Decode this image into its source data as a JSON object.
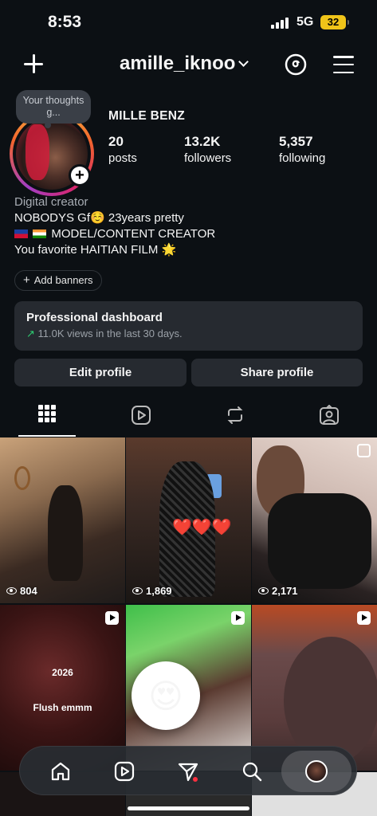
{
  "status_bar": {
    "time": "8:53",
    "network": "5G",
    "battery": "32"
  },
  "header": {
    "username": "amille_iknoo",
    "icons": [
      "plus-icon",
      "chevron-down-icon",
      "threads-icon",
      "menu-icon"
    ]
  },
  "profile": {
    "note": "Your thoughts g...",
    "display_name": "MILLE BENZ",
    "stats": {
      "posts": {
        "value": "20",
        "label": "posts"
      },
      "followers": {
        "value": "13.2K",
        "label": "followers"
      },
      "following": {
        "value": "5,357",
        "label": "following"
      }
    },
    "bio": {
      "category": "Digital creator",
      "line1": "NOBODYS Gf☺️ 23years pretty",
      "line2": "MODEL/CONTENT CREATOR",
      "line3": "You favorite HAITIAN FILM 🌟"
    },
    "add_banners": "Add banners"
  },
  "dashboard": {
    "title": "Professional dashboard",
    "subtitle": "11.0K views in the last 30 days."
  },
  "actions": {
    "edit": "Edit profile",
    "share": "Share profile"
  },
  "tabs": [
    "grid-icon",
    "reels-icon",
    "reposts-icon",
    "tagged-icon"
  ],
  "posts": [
    {
      "views": "804"
    },
    {
      "views": "1,869"
    },
    {
      "views": "2,171"
    },
    {
      "text_top": "2026",
      "text_mid": "Flush emmm"
    },
    {},
    {}
  ],
  "floating_emoji": "😍",
  "bottom_nav": [
    "home-icon",
    "reels-icon",
    "messages-icon",
    "search-icon",
    "profile-avatar"
  ]
}
